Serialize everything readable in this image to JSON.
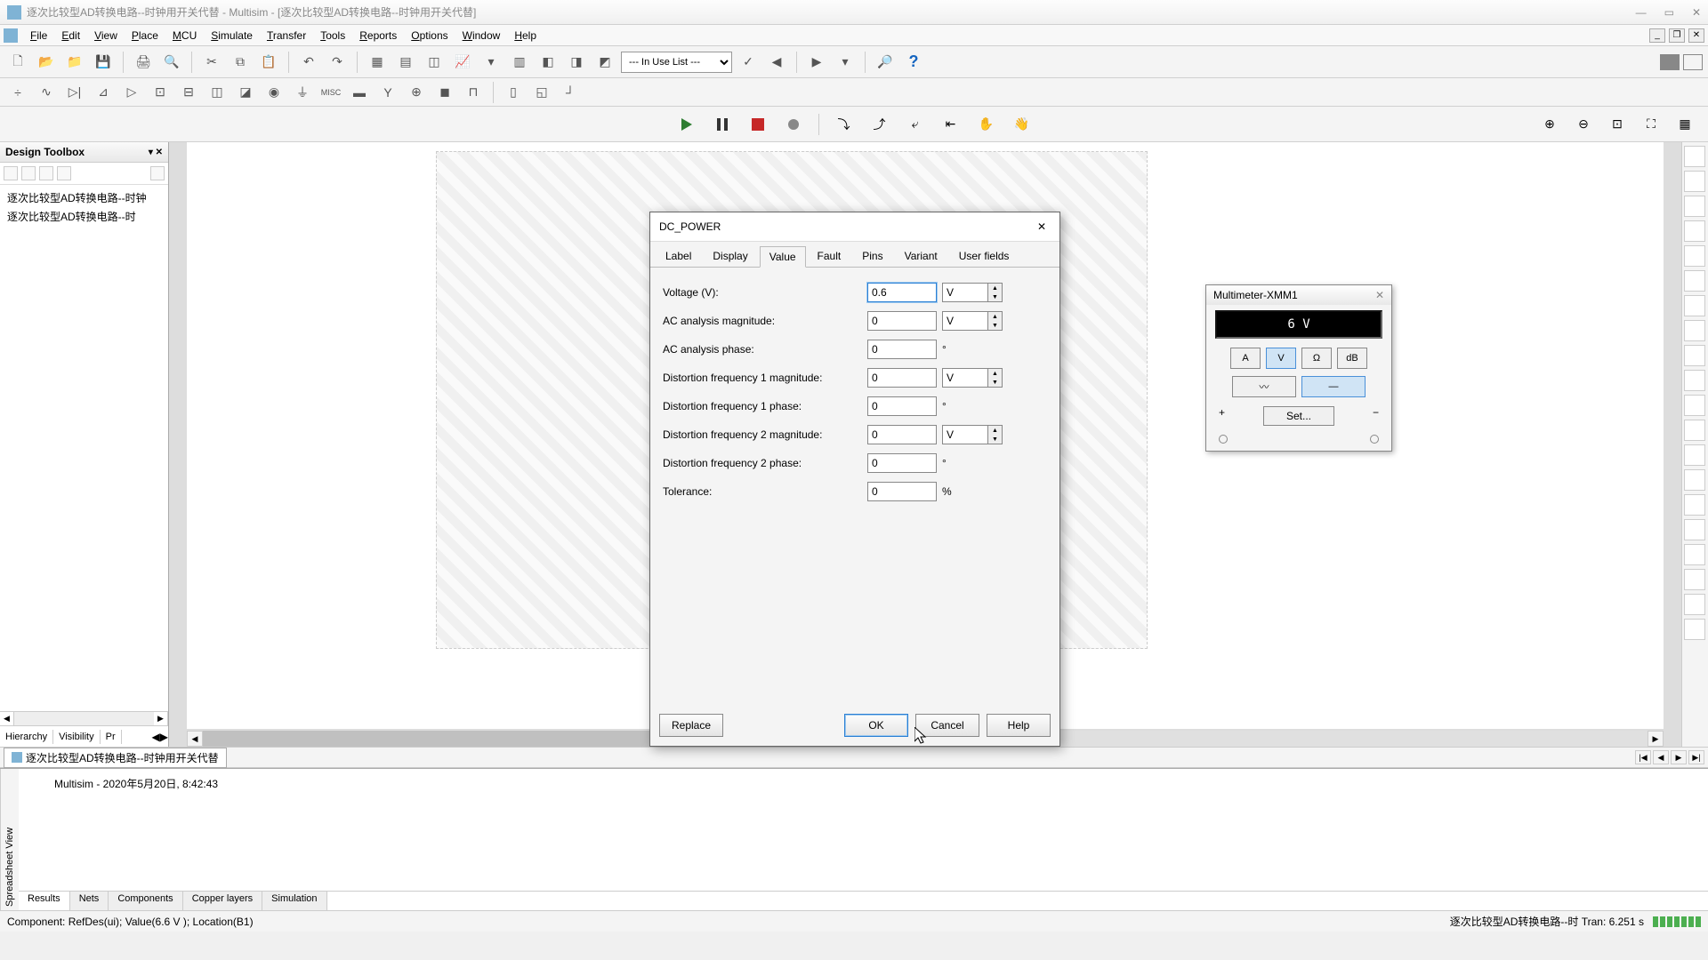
{
  "window": {
    "title": "逐次比较型AD转换电路--时钟用开关代替 - Multisim - [逐次比较型AD转换电路--时钟用开关代替]"
  },
  "menu": {
    "items": [
      "File",
      "Edit",
      "View",
      "Place",
      "MCU",
      "Simulate",
      "Transfer",
      "Tools",
      "Reports",
      "Options",
      "Window",
      "Help"
    ]
  },
  "toolbar1_combo": "--- In Use List ---",
  "toolbox": {
    "title": "Design Toolbox",
    "items": [
      "逐次比较型AD转换电路--时钟",
      "逐次比较型AD转换电路--时"
    ],
    "tabs": [
      "Hierarchy",
      "Visibility",
      "Pr"
    ]
  },
  "doc_tab": "逐次比较型AD转换电路--时钟用开关代替",
  "multimeter": {
    "title": "Multimeter-XMM1",
    "display": "6 V",
    "modes": [
      "A",
      "V",
      "Ω",
      "dB"
    ],
    "set_label": "Set..."
  },
  "dialog": {
    "title": "DC_POWER",
    "tabs": [
      "Label",
      "Display",
      "Value",
      "Fault",
      "Pins",
      "Variant",
      "User fields"
    ],
    "active_tab": 2,
    "rows": [
      {
        "label": "Voltage (V):",
        "value": "0.6",
        "unit": "V",
        "has_unit_select": true,
        "focus": true
      },
      {
        "label": "AC analysis magnitude:",
        "value": "0",
        "unit": "V",
        "has_unit_select": true,
        "focus": false
      },
      {
        "label": "AC analysis phase:",
        "value": "0",
        "unit": "°",
        "has_unit_select": false,
        "focus": false
      },
      {
        "label": "Distortion frequency 1 magnitude:",
        "value": "0",
        "unit": "V",
        "has_unit_select": true,
        "focus": false
      },
      {
        "label": "Distortion frequency 1 phase:",
        "value": "0",
        "unit": "°",
        "has_unit_select": false,
        "focus": false
      },
      {
        "label": "Distortion frequency 2 magnitude:",
        "value": "0",
        "unit": "V",
        "has_unit_select": true,
        "focus": false
      },
      {
        "label": "Distortion frequency 2 phase:",
        "value": "0",
        "unit": "°",
        "has_unit_select": false,
        "focus": false
      },
      {
        "label": "Tolerance:",
        "value": "0",
        "unit": "%",
        "has_unit_select": false,
        "focus": false
      }
    ],
    "buttons": {
      "replace": "Replace",
      "ok": "OK",
      "cancel": "Cancel",
      "help": "Help"
    }
  },
  "spreadsheet": {
    "side_label": "Spreadsheet View",
    "line": "Multisim  -  2020年5月20日, 8:42:43",
    "tabs": [
      "Results",
      "Nets",
      "Components",
      "Copper layers",
      "Simulation"
    ]
  },
  "status": {
    "left": "Component: RefDes(ui); Value(6.6 V ); Location(B1)",
    "right": "逐次比较型AD转换电路--时 Tran: 6.251 s"
  }
}
